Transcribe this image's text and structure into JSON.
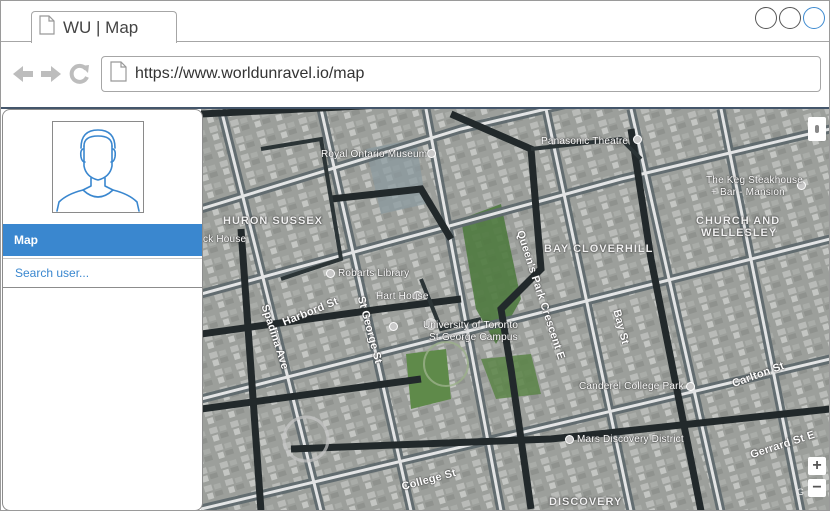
{
  "window": {
    "tab_title": "WU | Map",
    "controls": [
      "minimize",
      "restore",
      "maximize"
    ]
  },
  "toolbar": {
    "back_icon": "arrow-left-icon",
    "forward_icon": "arrow-right-icon",
    "reload_icon": "reload-icon",
    "url": "https://www.worldunravel.io/map"
  },
  "sidebar": {
    "avatar_icon": "user-avatar-icon",
    "active_item": "Map",
    "search_placeholder": "Search user...",
    "accent_color": "#3a87cf"
  },
  "map": {
    "areas": [
      "HURON SUSSEX",
      "BAY CLOVERHILL",
      "CHURCH AND",
      "WELLESLEY",
      "DISCOVERY"
    ],
    "places": [
      "Royal Ontario Museum",
      "Panasonic Theatre",
      "The Keg Steakhouse",
      "+ Bar - Mansion",
      "Robarts Library",
      "Hart House",
      "University of Toronto",
      "St George Campus",
      "Canderel College Park",
      "Mars Discovery District",
      "ck House"
    ],
    "streets": [
      "Harbord St",
      "St George St",
      "Spadina Ave",
      "Queen's Park Crescent E",
      "College St",
      "Bay St",
      "Carlton St",
      "Gerrard St E"
    ],
    "zoom_in": "+",
    "zoom_out": "−",
    "copyright": "G"
  }
}
